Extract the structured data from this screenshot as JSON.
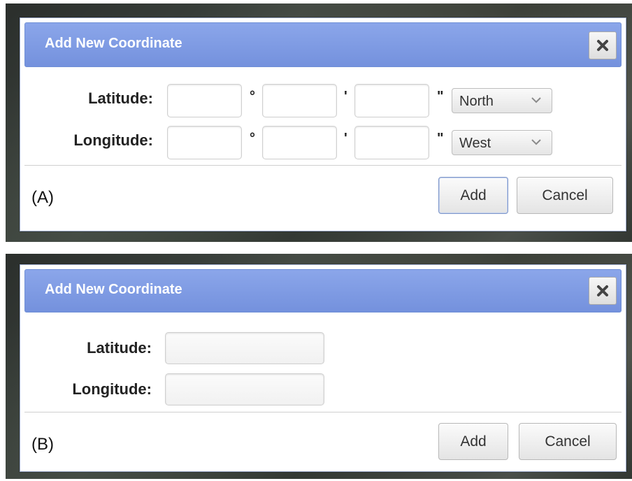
{
  "dialogs": [
    {
      "title": "Add New Coordinate",
      "variant_label": "(A)",
      "latitude": {
        "label": "Latitude:",
        "degrees": "",
        "minutes": "",
        "seconds": "",
        "degree_symbol": "°",
        "minute_symbol": "'",
        "second_symbol": "\"",
        "direction": "North"
      },
      "longitude": {
        "label": "Longitude:",
        "degrees": "",
        "minutes": "",
        "seconds": "",
        "degree_symbol": "°",
        "minute_symbol": "'",
        "second_symbol": "\"",
        "direction": "West"
      },
      "buttons": {
        "add": "Add",
        "cancel": "Cancel"
      },
      "close_icon": "close-x-icon"
    },
    {
      "title": "Add New Coordinate",
      "variant_label": "(B)",
      "latitude": {
        "label": "Latitude:",
        "value": ""
      },
      "longitude": {
        "label": "Longitude:",
        "value": ""
      },
      "buttons": {
        "add": "Add",
        "cancel": "Cancel"
      },
      "close_icon": "close-x-icon"
    }
  ],
  "colors": {
    "header_blue": "#7f9be3",
    "header_text": "#ffffff",
    "dialog_bg": "#ffffff"
  }
}
